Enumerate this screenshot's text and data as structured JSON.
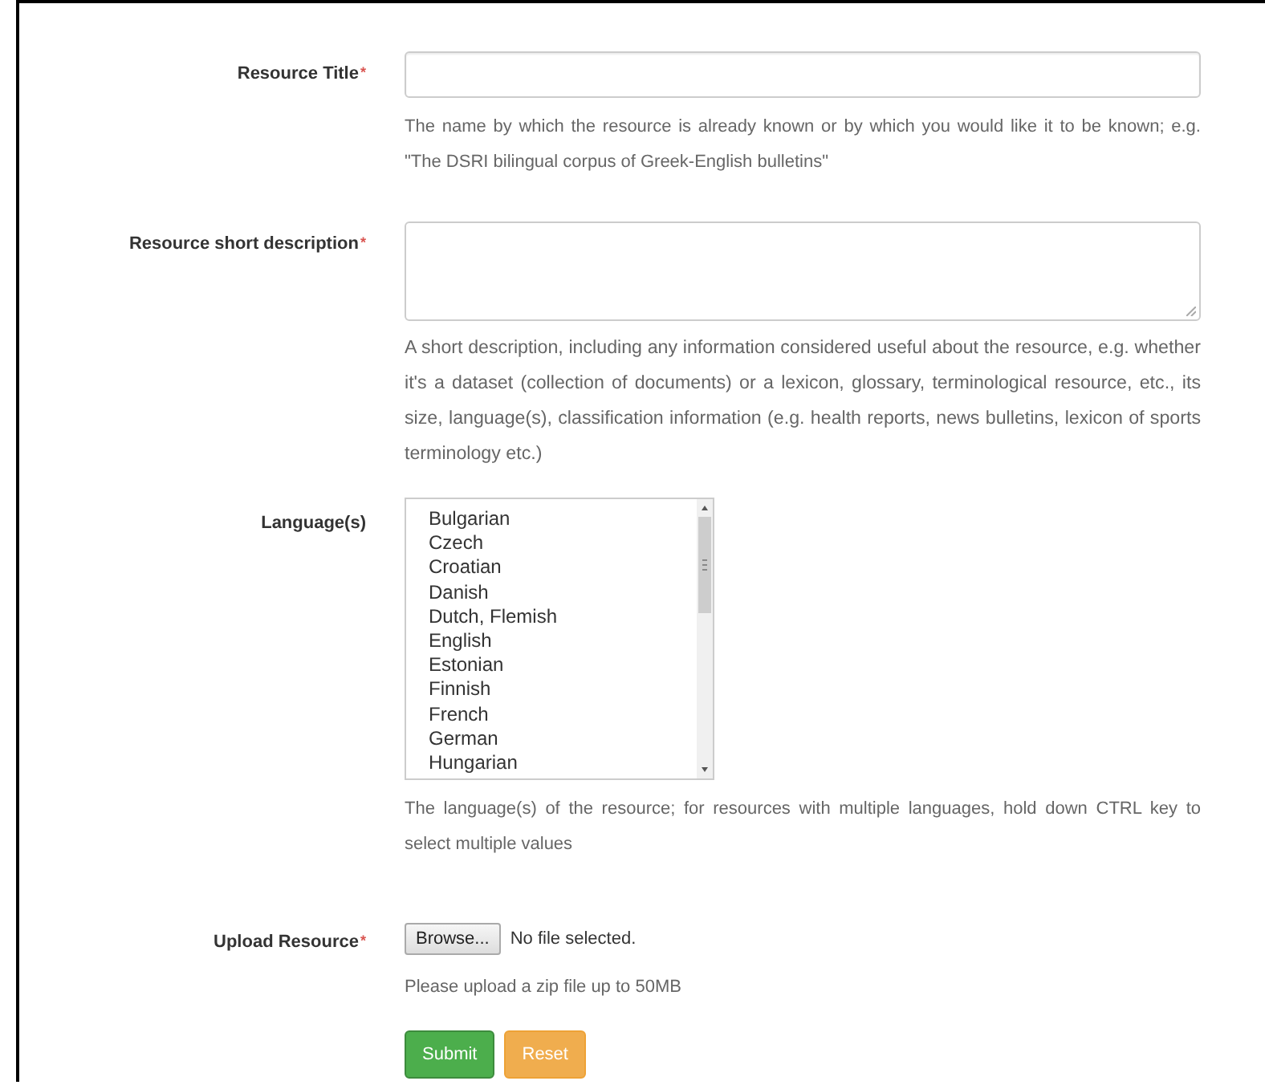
{
  "fields": [
    {
      "kind": "input",
      "label": "Resource Title",
      "mark": "*",
      "help": "The name by which the resource is already known or by which you would like it to be known; e.g. \"The DSRI bilingual corpus of Greek-English bulletins\""
    },
    {
      "kind": "textarea",
      "label": "Resource short description",
      "mark": "*",
      "help": "A short description, including any information considered useful about the resource, e.g. whether it's a dataset (collection of documents) or a lexicon, glossary, terminological resource, etc., its size, language(s), classification information (e.g. health reports, news bulletins, lexicon of sports terminology etc.)"
    },
    {
      "kind": "multiselect",
      "label": "Language(s)",
      "options": [
        "Bulgarian",
        "Czech",
        "Croatian",
        "Danish",
        "Dutch, Flemish",
        "English",
        "Estonian",
        "Finnish",
        "French",
        "German",
        "Hungarian"
      ],
      "help": "The language(s) of the resource; for resources with multiple languages, hold down CTRL key to select multiple values"
    },
    {
      "kind": "file",
      "label": "Upload Resource",
      "mark": "*",
      "browse": "Browse...",
      "status": "No file selected.",
      "help": "Please upload a zip file up to 50MB"
    }
  ],
  "buttons": [
    {
      "label": "Submit",
      "kind": "primary"
    },
    {
      "label": "Reset",
      "kind": "warning"
    }
  ]
}
